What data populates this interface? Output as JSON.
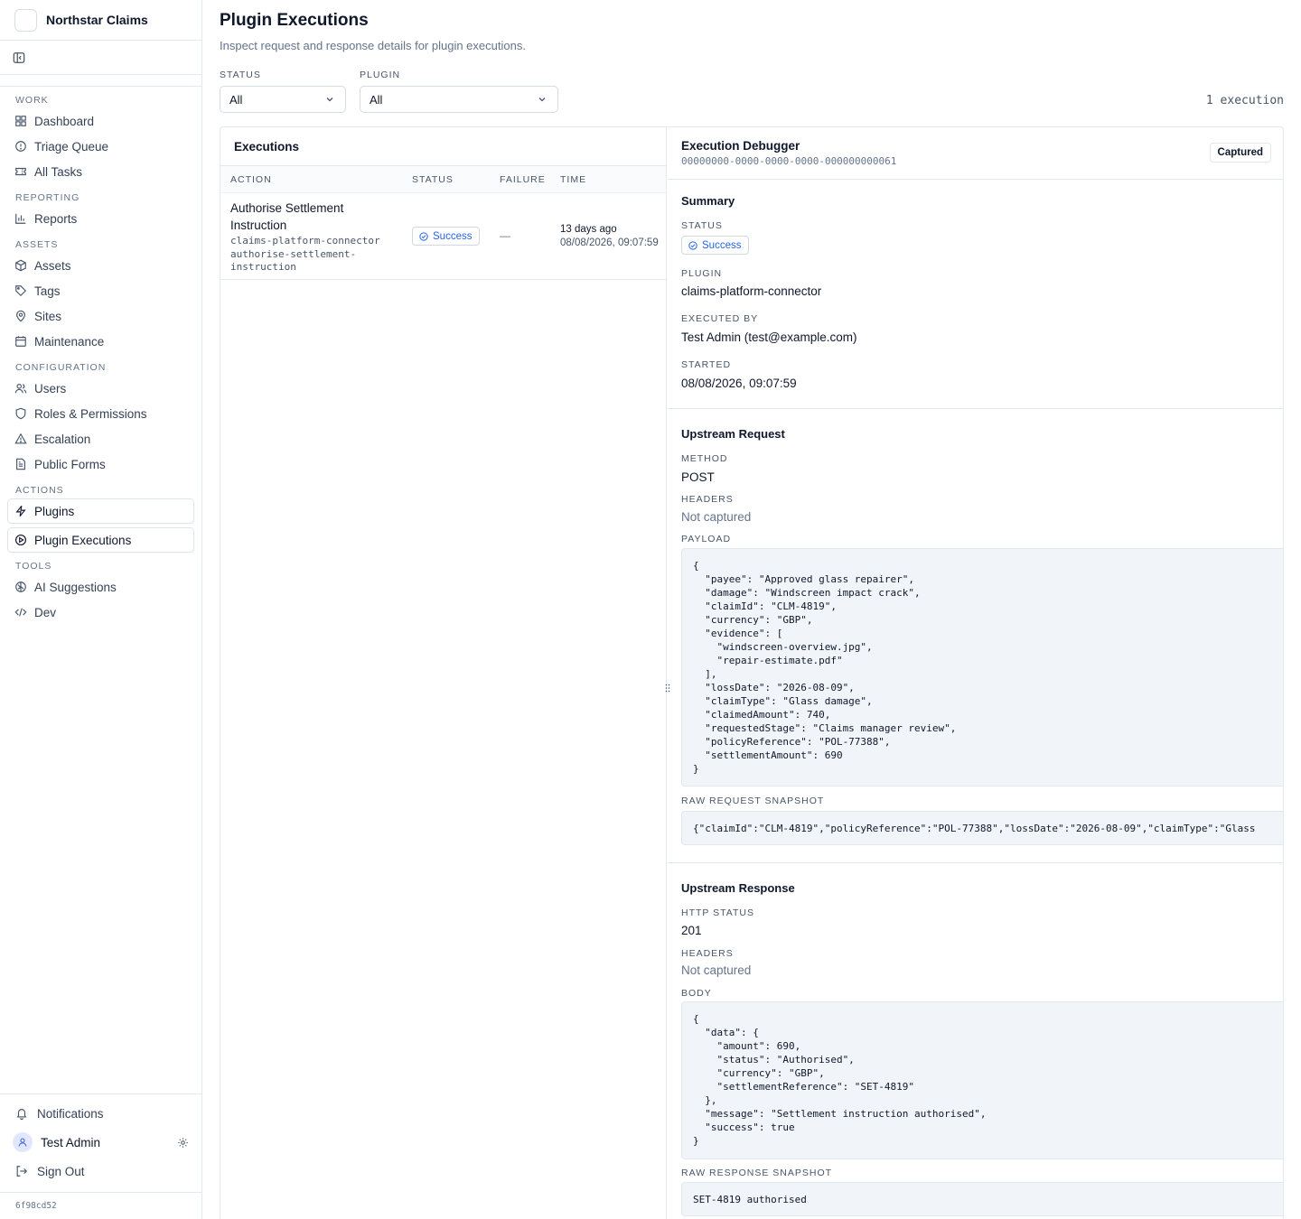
{
  "app": {
    "name": "Northstar Claims",
    "version": "6f98cd52"
  },
  "sidebar": {
    "sections": [
      {
        "title": "WORK",
        "items": [
          "Dashboard",
          "Triage Queue",
          "All Tasks"
        ]
      },
      {
        "title": "REPORTING",
        "items": [
          "Reports"
        ]
      },
      {
        "title": "ASSETS",
        "items": [
          "Assets",
          "Tags",
          "Sites",
          "Maintenance"
        ]
      },
      {
        "title": "CONFIGURATION",
        "items": [
          "Users",
          "Roles & Permissions",
          "Escalation",
          "Public Forms"
        ]
      },
      {
        "title": "ACTIONS",
        "items": [
          "Plugins",
          "Plugin Executions"
        ]
      },
      {
        "title": "TOOLS",
        "items": [
          "AI Suggestions",
          "Dev"
        ]
      }
    ],
    "footer": {
      "notifications": "Notifications",
      "user": "Test Admin",
      "sign_out": "Sign Out"
    }
  },
  "page": {
    "title": "Plugin Executions",
    "subtitle": "Inspect request and response details for plugin executions.",
    "filters": {
      "status_label": "STATUS",
      "status_value": "All",
      "plugin_label": "PLUGIN",
      "plugin_value": "All"
    },
    "count": "1 execution"
  },
  "executions": {
    "title": "Executions",
    "columns": {
      "action": "ACTION",
      "status": "STATUS",
      "failure": "FAILURE",
      "time": "TIME"
    },
    "rows": [
      {
        "title": "Authorise Settlement Instruction",
        "plugin": "claims-platform-connector",
        "action_id": "authorise-settlement-instruction",
        "status": "Success",
        "failure": "—",
        "time_relative": "13 days ago",
        "time_absolute": "08/08/2026, 09:07:59"
      }
    ]
  },
  "debugger": {
    "title": "Execution Debugger",
    "id": "00000000-0000-0000-0000-000000000061",
    "badge": "Captured",
    "summary": {
      "title": "Summary",
      "status_label": "STATUS",
      "status": "Success",
      "plugin_label": "PLUGIN",
      "plugin": "claims-platform-connector",
      "executed_by_label": "EXECUTED BY",
      "executed_by": "Test Admin (test@example.com)",
      "started_label": "STARTED",
      "started": "08/08/2026, 09:07:59"
    },
    "request": {
      "title": "Upstream Request",
      "method_label": "METHOD",
      "method": "POST",
      "headers_label": "HEADERS",
      "headers": "Not captured",
      "payload_label": "PAYLOAD",
      "payload": "{\n  \"payee\": \"Approved glass repairer\",\n  \"damage\": \"Windscreen impact crack\",\n  \"claimId\": \"CLM-4819\",\n  \"currency\": \"GBP\",\n  \"evidence\": [\n    \"windscreen-overview.jpg\",\n    \"repair-estimate.pdf\"\n  ],\n  \"lossDate\": \"2026-08-09\",\n  \"claimType\": \"Glass damage\",\n  \"claimedAmount\": 740,\n  \"requestedStage\": \"Claims manager review\",\n  \"policyReference\": \"POL-77388\",\n  \"settlementAmount\": 690\n}",
      "raw_label": "RAW REQUEST SNAPSHOT",
      "raw": "{\"claimId\":\"CLM-4819\",\"policyReference\":\"POL-77388\",\"lossDate\":\"2026-08-09\",\"claimType\":\"Glass"
    },
    "response": {
      "title": "Upstream Response",
      "status_label": "HTTP STATUS",
      "status": "201",
      "headers_label": "HEADERS",
      "headers": "Not captured",
      "body_label": "BODY",
      "body": "{\n  \"data\": {\n    \"amount\": 690,\n    \"status\": \"Authorised\",\n    \"currency\": \"GBP\",\n    \"settlementReference\": \"SET-4819\"\n  },\n  \"message\": \"Settlement instruction authorised\",\n  \"success\": true\n}",
      "raw_label": "RAW RESPONSE SNAPSHOT",
      "raw": "SET-4819 authorised"
    }
  },
  "colors": {
    "accent": "#2563eb",
    "border": "#e2e8f0",
    "code_bg": "#f1f5f9",
    "muted": "#64748b"
  }
}
